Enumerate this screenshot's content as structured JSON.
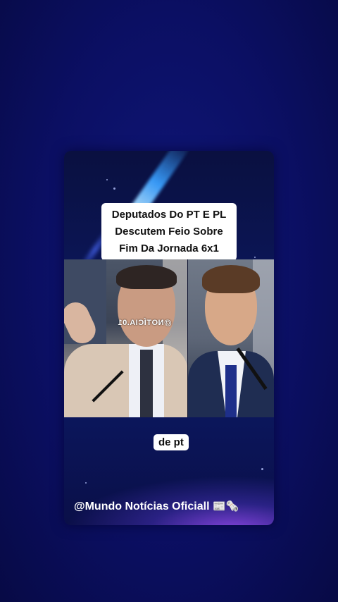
{
  "headline": {
    "line1": "Deputados Do PT E PL",
    "line2": "Descutem Feio Sobre",
    "line3": "Fim Da Jornada 6x1"
  },
  "photo": {
    "watermark": "@NOTÍCIA.01"
  },
  "caption": "de pt",
  "footer": {
    "handle": "@Mundo Notícias Oficiall",
    "icons": "📰🗞️"
  }
}
